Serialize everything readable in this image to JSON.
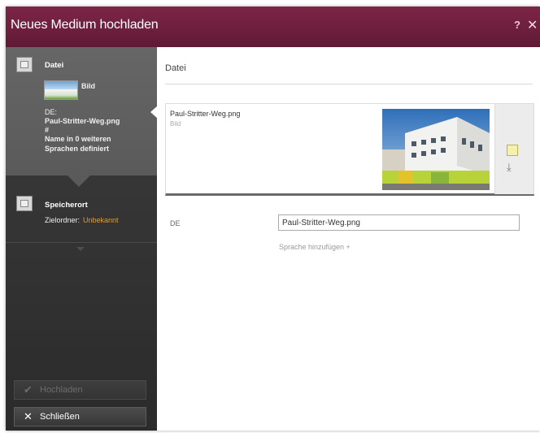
{
  "dialog": {
    "title": "Neues Medium hochladen",
    "help_label": "?",
    "close_label": "✕"
  },
  "sidebar": {
    "file_step": {
      "title": "Datei",
      "thumb_label": "Bild",
      "lang": "DE:",
      "filename": "Paul-Stritter-Weg.png",
      "hash": "#",
      "note": "Name in 0 weiteren Sprachen definiert"
    },
    "location_step": {
      "title": "Speicherort",
      "folder_label": "Zielordner:",
      "folder_value": "Unbekannt"
    },
    "buttons": {
      "confirm_label": "Hochladen",
      "close_label": "Schließen"
    }
  },
  "main": {
    "header": "Datei",
    "file": {
      "name": "Paul-Stritter-Weg.png",
      "type": "Bild"
    },
    "language": "DE",
    "name_field_value": "Paul-Stritter-Weg.png",
    "add_language": "Sprache hinzufügen +"
  },
  "colors": {
    "titlebar": "#6e1f3d",
    "accent_orange": "#e39b2c",
    "sidebar_dark": "#2b2b2b"
  },
  "icons": [
    "file-icon",
    "folder-icon",
    "check-icon",
    "close-icon",
    "help-icon",
    "edit-icon",
    "upload-icon"
  ]
}
